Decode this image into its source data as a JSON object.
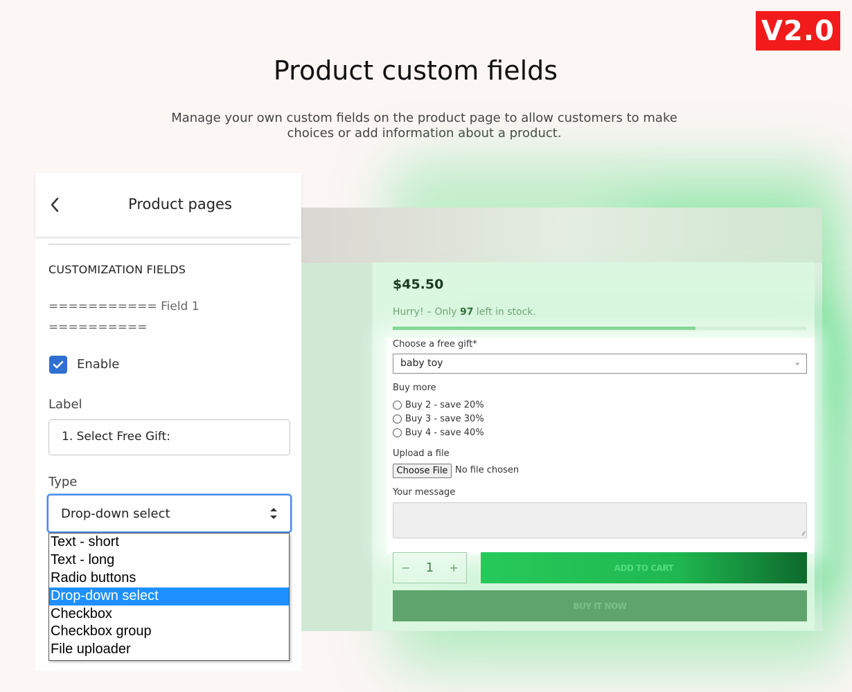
{
  "badge": {
    "version": "V2.0",
    "color": "#f21b1b"
  },
  "hero": {
    "title": "Product custom fields",
    "subtitle": "Manage your own custom fields on the product page to allow customers to make choices or add information about a product."
  },
  "settings": {
    "title": "Product pages",
    "back_icon": "chevron-left-icon",
    "section_title": "CUSTOMIZATION FIELDS",
    "field_separator": "=========== Field 1 ==========",
    "enable": {
      "label": "Enable",
      "checked": true
    },
    "label_field": {
      "label": "Label",
      "value": "1. Select Free Gift:"
    },
    "type_field": {
      "label": "Type",
      "value": "Drop-down select",
      "options": [
        "Text - short",
        "Text - long",
        "Radio buttons",
        "Drop-down select",
        "Checkbox",
        "Checkbox group",
        "File uploader"
      ],
      "selected_index": 3
    },
    "accent_color": "#2f6fd1"
  },
  "product": {
    "price": "$45.50",
    "stock": {
      "prefix": "Hurry! – Only ",
      "count": "97",
      "suffix": " left in stock.",
      "level": 0.73
    },
    "gift": {
      "label": "Choose a free gift*",
      "value": "baby toy"
    },
    "buy_more": {
      "label": "Buy more",
      "options": [
        "Buy 2 - save 20%",
        "Buy 3 - save 30%",
        "Buy 4 - save 40%"
      ]
    },
    "upload": {
      "label": "Upload a file",
      "button": "Choose File",
      "status": "No file chosen"
    },
    "message": {
      "label": "Your message",
      "value": ""
    },
    "quantity": {
      "minus": "−",
      "value": "1",
      "plus": "+"
    },
    "add_to_cart": "ADD TO CART",
    "buy_now": "BUY IT NOW",
    "accent_color": "#22c55e"
  }
}
